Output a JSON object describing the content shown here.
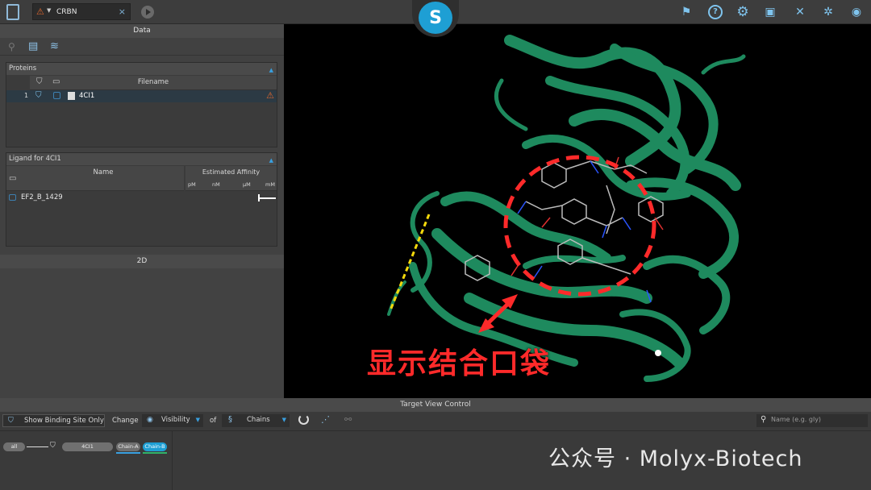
{
  "topbar": {
    "tab_name": "CRBN",
    "icons": [
      "document-icon",
      "warning-icon",
      "close-icon",
      "play-icon",
      "docking-alert-icon",
      "help-icon",
      "settings-icon",
      "monitor-icon",
      "tools-icon",
      "molecule-tools-icon",
      "eye-icon"
    ]
  },
  "logo_letter": "S",
  "left": {
    "data_header": "Data",
    "proteins": {
      "title": "Proteins",
      "col_filename": "Filename",
      "row_index": "1",
      "row_name": "4CI1"
    },
    "ligand": {
      "title": "Ligand for 4CI1",
      "col_name": "Name",
      "col_affinity": "Estimated Affinity",
      "units": [
        "pM",
        "nM",
        "µM",
        "mM"
      ],
      "row_name": "EF2_B_1429"
    },
    "twod_header": "2D"
  },
  "viewer": {
    "annotation": "显示结合口袋"
  },
  "bottom": {
    "title": "Target View Control",
    "show_binding": "Show Binding Site Only",
    "change": "Change",
    "visibility": "Visibility",
    "of": "of",
    "chains": "Chains",
    "search_placeholder": "Name (e.g. gly)",
    "all": "all",
    "protein": "4CI1",
    "chain_a": "Chain-A",
    "chain_b": "Chain-B"
  },
  "watermark": "公众号 · Molyx-Biotech",
  "colors": {
    "accent": "#1e9fd4",
    "ribbon": "#1e8a5e",
    "warning": "#e0682f",
    "annotation": "#ff2a2a"
  }
}
